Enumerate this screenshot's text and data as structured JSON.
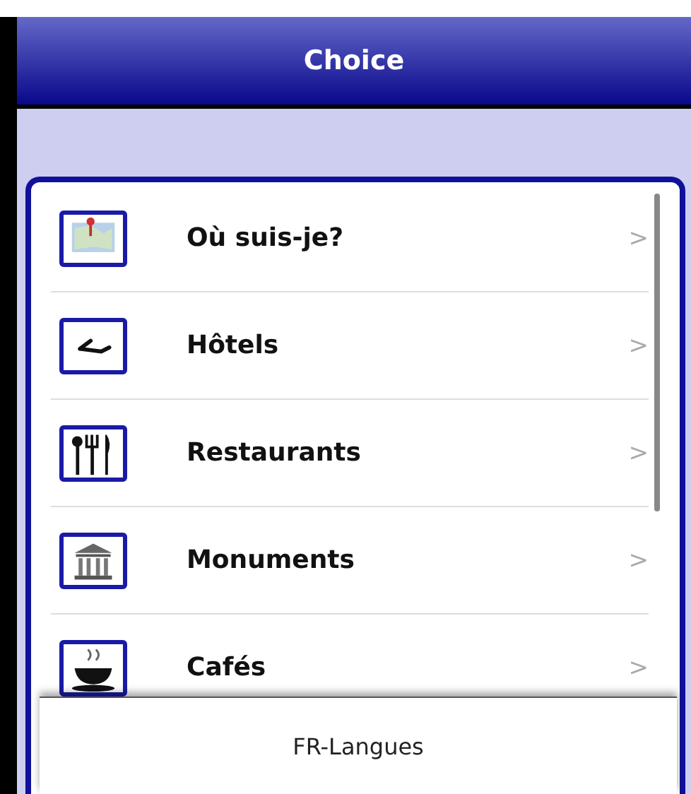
{
  "header": {
    "title": "Choice"
  },
  "menu": [
    {
      "kind": "map",
      "label": "Où suis-je?",
      "chevron": ">"
    },
    {
      "kind": "hotel",
      "label": "Hôtels",
      "chevron": ">"
    },
    {
      "kind": "cutlery",
      "label": "Restaurants",
      "chevron": ">"
    },
    {
      "kind": "monument",
      "label": "Monuments",
      "chevron": ">"
    },
    {
      "kind": "cafe",
      "label": "Cafés",
      "chevron": ">"
    }
  ],
  "popup": {
    "label": "FR-Langues"
  }
}
